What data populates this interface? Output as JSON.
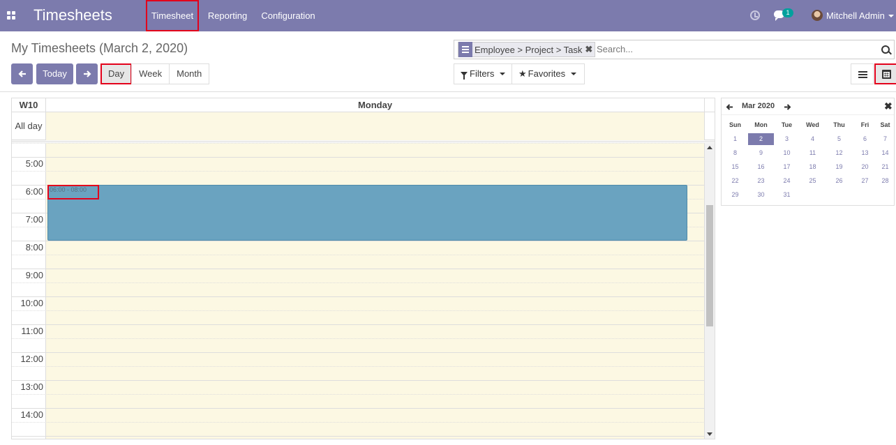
{
  "app": {
    "brand": "Timesheets",
    "menu": [
      "Timesheet",
      "Reporting",
      "Configuration"
    ],
    "chat_badge": "1",
    "user_name": "Mitchell Admin"
  },
  "control": {
    "title": "My Timesheets (March 2, 2020)",
    "today_label": "Today",
    "scales": [
      "Day",
      "Week",
      "Month"
    ],
    "facet_label": "Employee > Project > Task",
    "facet_remove": "✖",
    "search_placeholder": "Search...",
    "filters_label": "Filters",
    "favorites_label": "Favorites"
  },
  "calendar": {
    "week_label": "W10",
    "day_name": "Monday",
    "allday_label": "All day",
    "hours": [
      "5:00",
      "6:00",
      "7:00",
      "8:00",
      "9:00",
      "10:00",
      "11:00",
      "12:00",
      "13:00",
      "14:00"
    ],
    "event": {
      "time": "06:00 - 08:00",
      "color": "#6aa3c0"
    }
  },
  "mini_calendar": {
    "title": "Mar 2020",
    "close": "✖",
    "days_of_week": [
      "Sun",
      "Mon",
      "Tue",
      "Wed",
      "Thu",
      "Fri",
      "Sat"
    ],
    "weeks": [
      [
        "1",
        "2",
        "3",
        "4",
        "5",
        "6",
        "7"
      ],
      [
        "8",
        "9",
        "10",
        "11",
        "12",
        "13",
        "14"
      ],
      [
        "15",
        "16",
        "17",
        "18",
        "19",
        "20",
        "21"
      ],
      [
        "22",
        "23",
        "24",
        "25",
        "26",
        "27",
        "28"
      ],
      [
        "29",
        "30",
        "31",
        "",
        "",
        "",
        ""
      ]
    ],
    "selected": "2"
  },
  "colors": {
    "brand": "#7c7bad",
    "highlight": "#e3001b",
    "today_bg": "#fcf8e3"
  }
}
